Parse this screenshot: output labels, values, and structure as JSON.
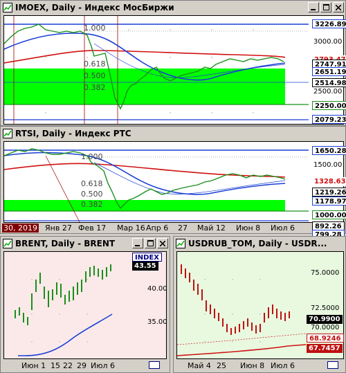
{
  "windows": [
    {
      "title": "IMOEX, Daily - Индекс МосБиржи",
      "fib_labels": [
        "1.000",
        "0.618",
        "0.500",
        "0.382"
      ],
      "price_tags": [
        {
          "value": "3226.89",
          "bg": "#ffffff",
          "fg": "#000000"
        },
        {
          "value": "2793.47",
          "bg": "#ffffff",
          "fg": "#000000"
        },
        {
          "value": "2747.91",
          "bg": "#ffffff",
          "fg": "#000000"
        },
        {
          "value": "2651.19",
          "bg": "#ffffff",
          "fg": "#000000"
        },
        {
          "value": "2514.98",
          "bg": "#ffffff",
          "fg": "#000000"
        },
        {
          "value": "2250.00",
          "bg": "#ffffff",
          "fg": "#000000"
        },
        {
          "value": "2079.23",
          "bg": "#ffffff",
          "fg": "#000000"
        }
      ],
      "axis_labels": [
        "3000.00",
        "2500.00"
      ]
    },
    {
      "title": "RTSI, Daily - Индекс РТС",
      "fib_labels": [
        "1.000",
        "0.618",
        "0.500",
        "0.382"
      ],
      "price_tags": [
        {
          "value": "1650.28",
          "bg": "#ffffff",
          "fg": "#000000"
        },
        {
          "value": "1328.63",
          "bg": "#ffffff",
          "fg": "#000000"
        },
        {
          "value": "1219.26",
          "bg": "#ffffff",
          "fg": "#000000"
        },
        {
          "value": "1178.97",
          "bg": "#ffffff",
          "fg": "#000000"
        },
        {
          "value": "1000.00",
          "bg": "#ffffff",
          "fg": "#000000"
        },
        {
          "value": "892.26",
          "bg": "#ffffff",
          "fg": "#000000"
        },
        {
          "value": "799.28",
          "bg": "#ffffff",
          "fg": "#000000"
        }
      ],
      "axis_labels": [
        "1500.00"
      ],
      "xaxis": [
        "30, 2019",
        "Янв 27",
        "Фев 17",
        "Мар 16",
        "Апр 6",
        "27",
        "Май 12",
        "Июн 8",
        "Июл 6"
      ]
    },
    {
      "title": "BRENT, Daily - BRENT",
      "index_label": "INDEX",
      "price_tags": [
        {
          "value": "43.55"
        }
      ],
      "axis_labels": [
        "40.00",
        "35.00"
      ],
      "xaxis": [
        "Июн 1",
        "15",
        "22",
        "29",
        "Июл 6"
      ]
    },
    {
      "title": "USDRUB_TOM, Daily - USDR...",
      "price_tags": [
        {
          "value": "70.9900"
        },
        {
          "value": "68.9246"
        },
        {
          "value": "67.7457"
        }
      ],
      "axis_labels": [
        "75.0000",
        "72.5000",
        "70.0000"
      ],
      "xaxis": [
        "Май 4",
        "25",
        "Июн 8",
        "Июл 6"
      ]
    }
  ],
  "colors": {
    "green_zone": "#00ff00",
    "ma_blue": "#1a3fd4",
    "ma_red": "#d01010",
    "candle_green": "#1a8f1a",
    "candle_red": "#c01010",
    "brent_bg": "#fbe9e9",
    "usd_bg": "#e8f9e0"
  },
  "icons": [
    "chart-window-icon",
    "minimize-icon",
    "maximize-icon",
    "close-icon"
  ]
}
